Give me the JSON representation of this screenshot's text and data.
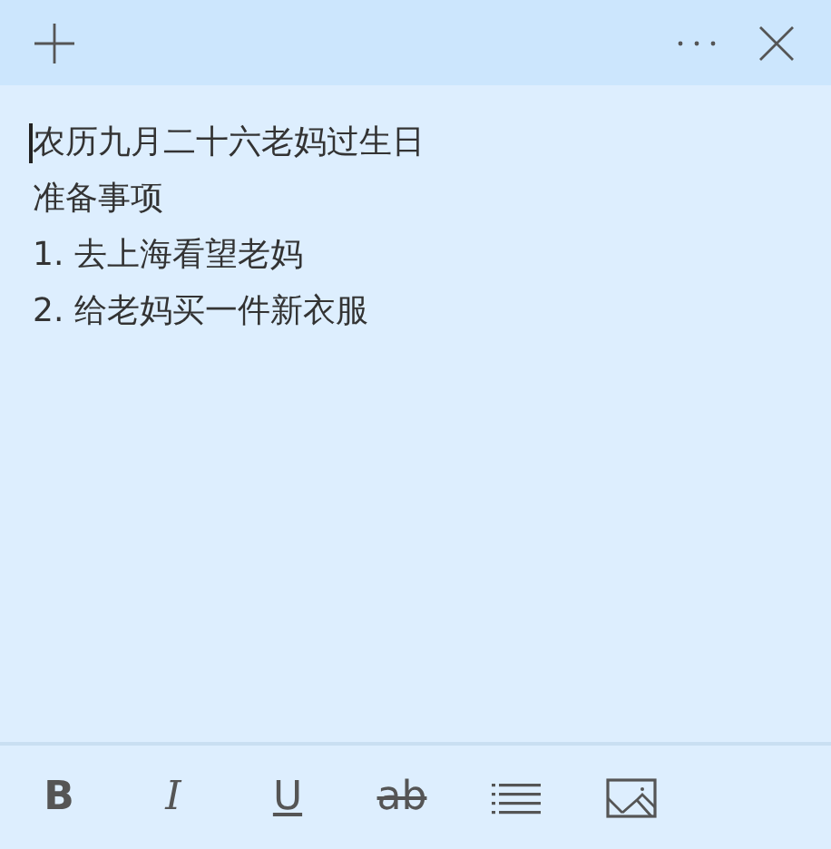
{
  "note": {
    "lines": [
      "农历九月二十六老妈过生日",
      "准备事项",
      "1. 去上海看望老妈",
      "2. 给老妈买一件新衣服"
    ]
  },
  "toolbar": [
    {
      "kind": "bold",
      "label": "B"
    },
    {
      "kind": "italic",
      "label": "I"
    },
    {
      "kind": "underline",
      "label": "U"
    },
    {
      "kind": "strike",
      "label": "ab"
    },
    {
      "kind": "list"
    },
    {
      "kind": "image"
    }
  ]
}
